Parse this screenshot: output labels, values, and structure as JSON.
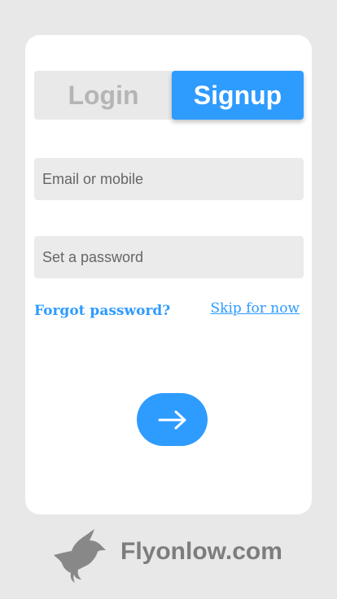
{
  "tabs": {
    "login_label": "Login",
    "signup_label": "Signup",
    "active": "signup"
  },
  "form": {
    "email_placeholder": "Email or mobile",
    "email_value": "",
    "password_placeholder": "Set a password",
    "password_value": ""
  },
  "links": {
    "forgot_password": "Forgot password?",
    "skip": "Skip for now"
  },
  "submit": {
    "icon": "arrow-right-icon"
  },
  "footer": {
    "logo_icon": "bird-icon",
    "brand": "Flyonlow.com"
  },
  "colors": {
    "accent": "#2e9bff",
    "background": "#e8e8e8",
    "card": "#ffffff",
    "field": "#ebebeb",
    "inactive_tab_text": "#b5b5b5",
    "brand_text": "#7d7d7d"
  }
}
